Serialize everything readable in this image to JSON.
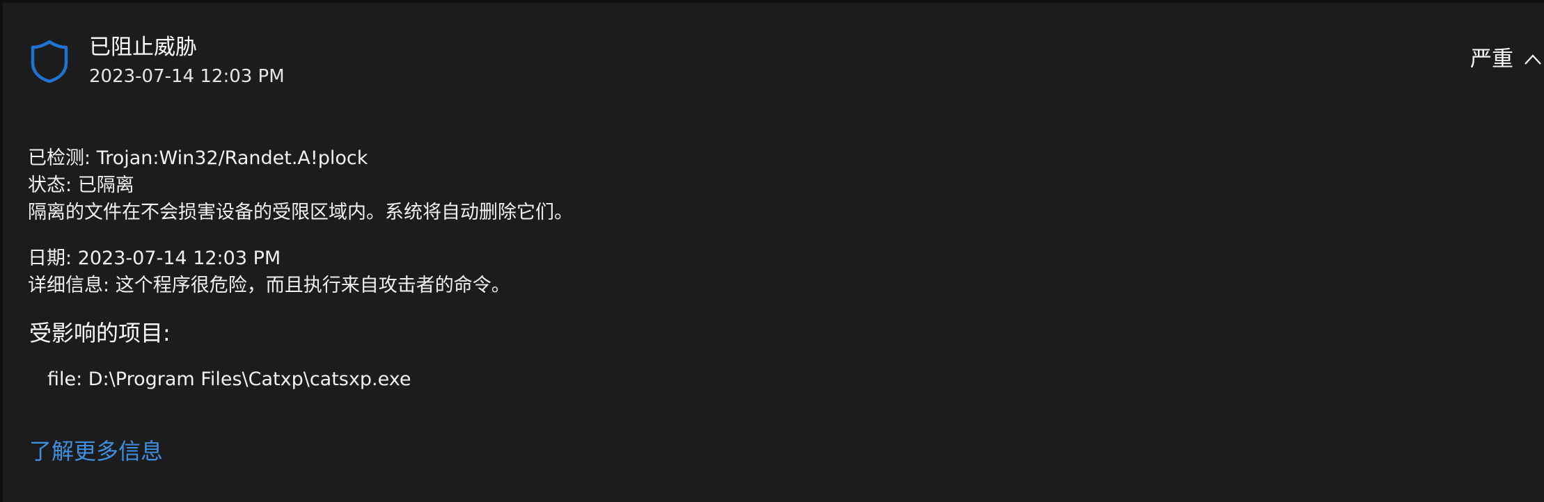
{
  "header": {
    "title": "已阻止威胁",
    "date": "2023-07-14 12:03 PM",
    "severity": "严重",
    "icon": "shield-icon",
    "toggle_icon": "chevron-up-icon"
  },
  "details": {
    "detected_label": "已检测:",
    "detected_value": "Trojan:Win32/Randet.A!plock",
    "status_label": "状态:",
    "status_value": "已隔离",
    "status_note": "隔离的文件在不会损害设备的受限区域内。系统将自动删除它们。",
    "date_label": "日期:",
    "date_value": "2023-07-14 12:03 PM",
    "info_label": "详细信息:",
    "info_value": "这个程序很危险，而且执行来自攻击者的命令。"
  },
  "affected": {
    "heading": "受影响的项目:",
    "items": [
      "file: D:\\Program Files\\Catxp\\catsxp.exe"
    ]
  },
  "learn_more": "了解更多信息",
  "colors": {
    "background": "#1c1c1c",
    "accent": "#3d8fe0",
    "shield": "#1f73d2"
  }
}
